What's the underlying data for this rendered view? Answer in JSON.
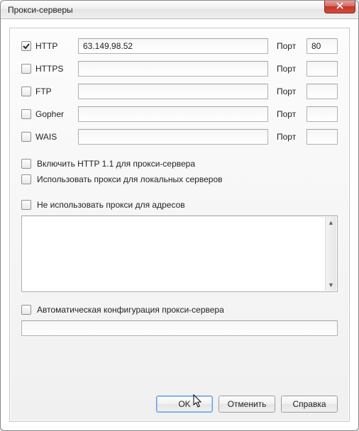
{
  "window": {
    "title": "Прокси-серверы"
  },
  "labels": {
    "port": "Порт"
  },
  "protocols": [
    {
      "name": "HTTP",
      "checked": true,
      "server": "63.149.98.52",
      "port": "80"
    },
    {
      "name": "HTTPS",
      "checked": false,
      "server": "",
      "port": ""
    },
    {
      "name": "FTP",
      "checked": false,
      "server": "",
      "port": ""
    },
    {
      "name": "Gopher",
      "checked": false,
      "server": "",
      "port": ""
    },
    {
      "name": "WAIS",
      "checked": false,
      "server": "",
      "port": ""
    }
  ],
  "options": {
    "http11": {
      "checked": false,
      "label": "Включить HTTP 1.1 для прокси-сервера"
    },
    "local": {
      "checked": false,
      "label": "Использовать прокси для локальных серверов"
    },
    "exclude": {
      "checked": false,
      "label": "Не использовать прокси для адресов"
    },
    "autoconf": {
      "checked": false,
      "label": "Автоматическая конфигурация прокси-сервера"
    }
  },
  "exclude_text": "",
  "autoconf_url": "",
  "buttons": {
    "ok": "OK",
    "cancel": "Отменить",
    "help": "Справка"
  }
}
